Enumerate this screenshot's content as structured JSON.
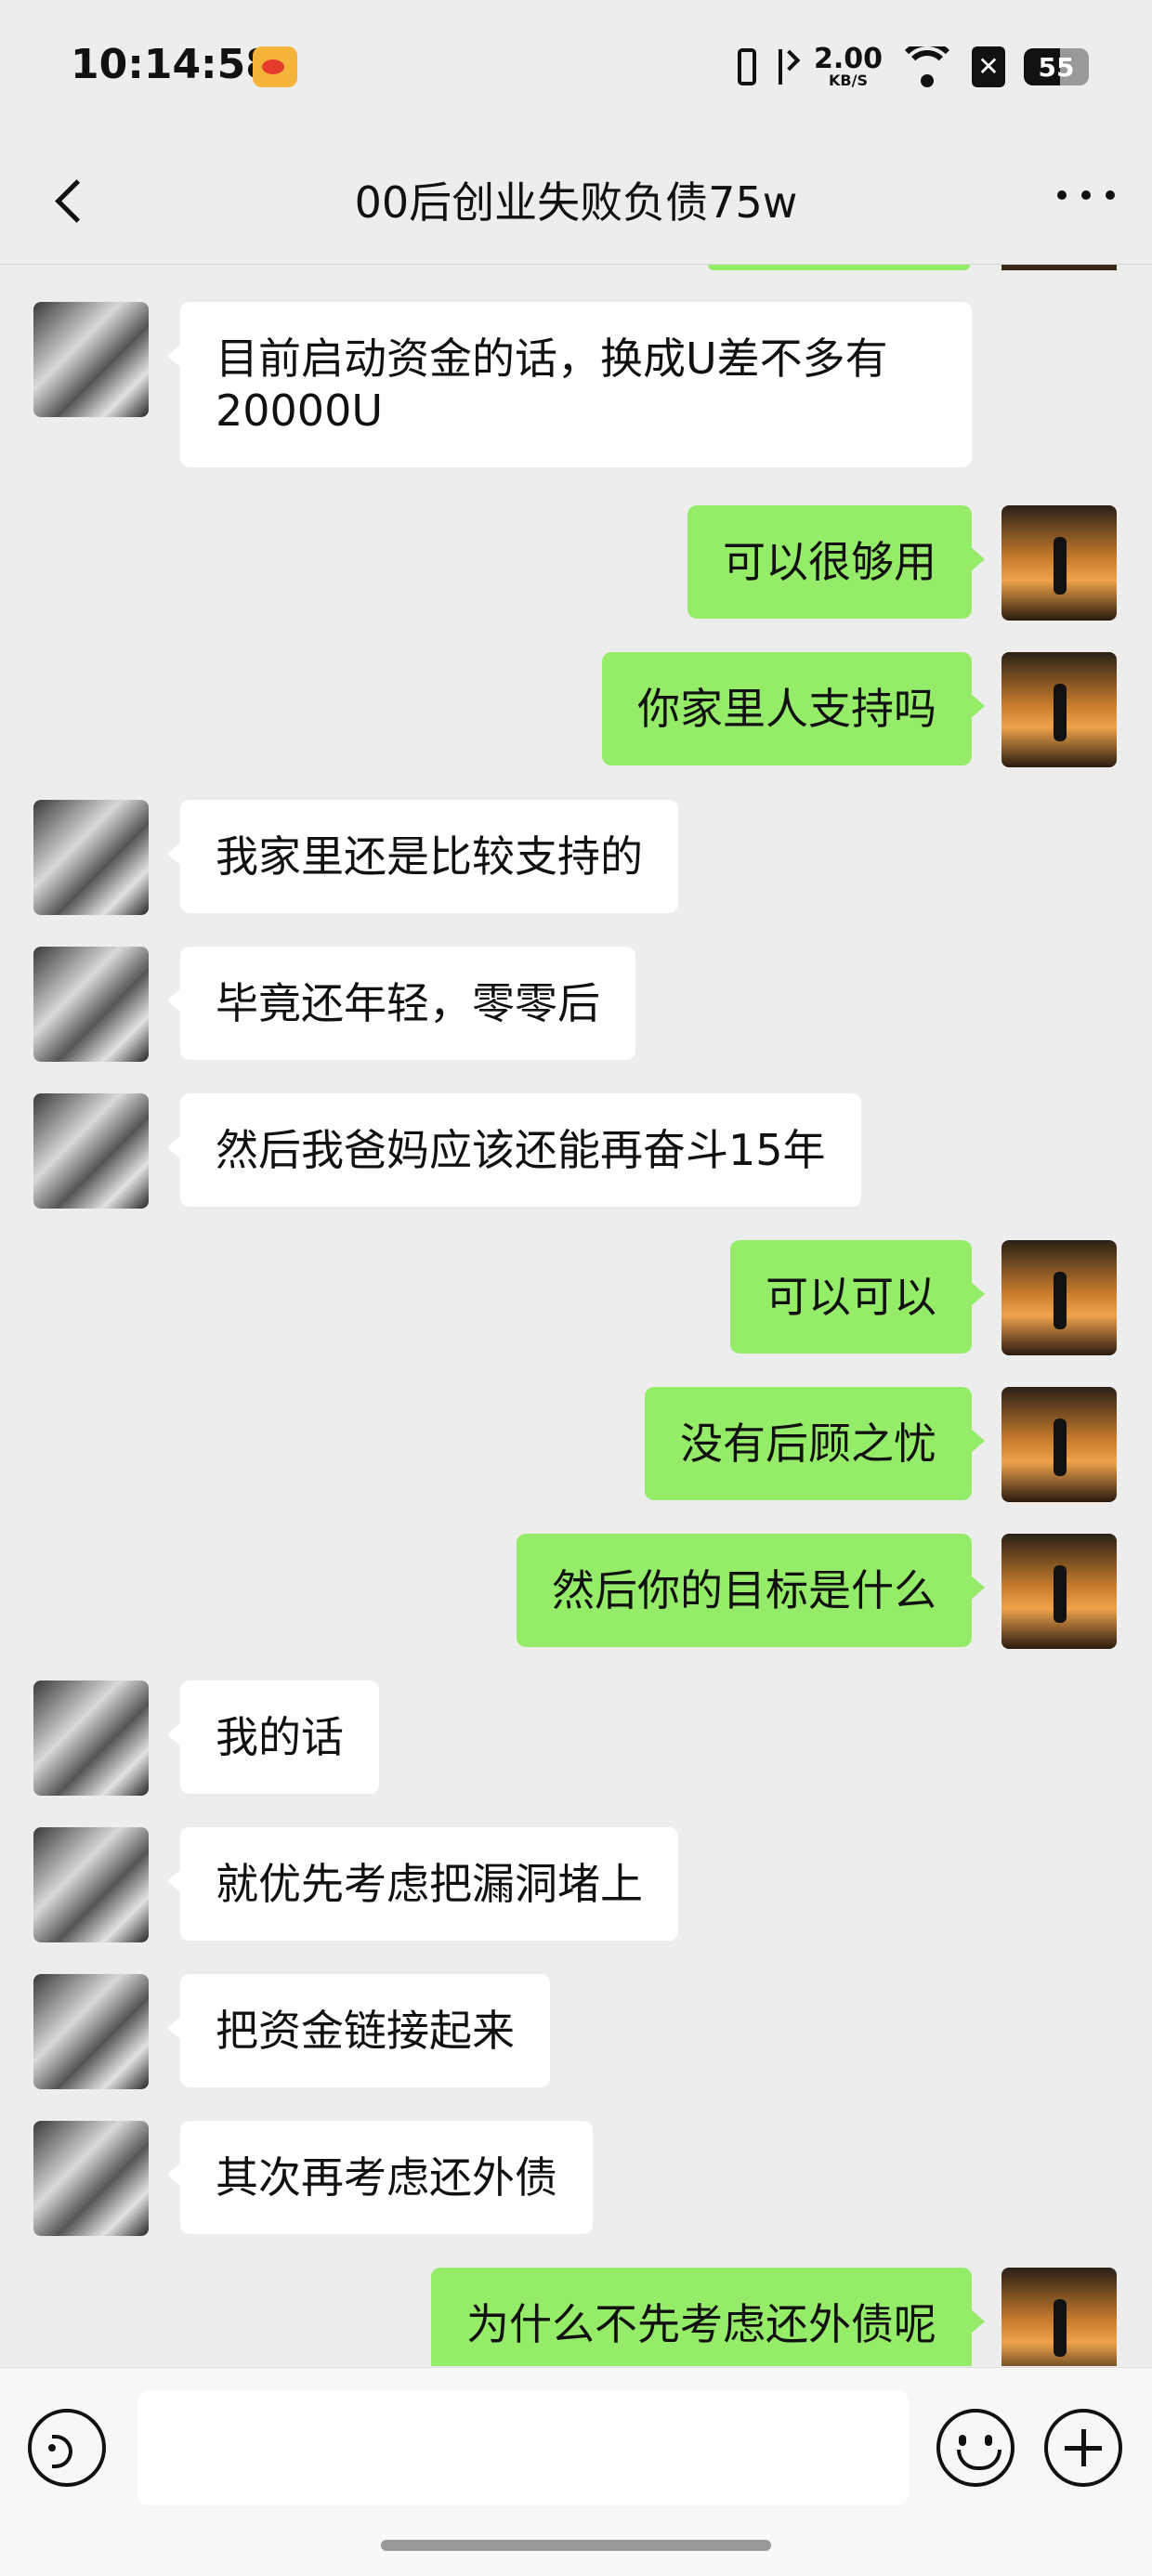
{
  "status_bar": {
    "time": "10:14:58",
    "net_speed_value": "2.00",
    "net_speed_unit": "KB/S",
    "battery": "55",
    "battery_level_percent": 55,
    "icons": [
      "weibo-icon",
      "vibrate-icon",
      "bluetooth-icon",
      "wifi-icon",
      "sim-off-icon",
      "battery-icon"
    ]
  },
  "nav": {
    "title": "00后创业失败负债75w",
    "icons": [
      "back-icon",
      "more-icon"
    ]
  },
  "messages": [
    {
      "side": "left",
      "text": "目前启动资金的话，换成U差不多有20000U"
    },
    {
      "side": "right",
      "text": "可以很够用"
    },
    {
      "side": "right",
      "text": "你家里人支持吗"
    },
    {
      "side": "left",
      "text": "我家里还是比较支持的"
    },
    {
      "side": "left",
      "text": "毕竟还年轻，零零后"
    },
    {
      "side": "left",
      "text": "然后我爸妈应该还能再奋斗15年"
    },
    {
      "side": "right",
      "text": "可以可以"
    },
    {
      "side": "right",
      "text": "没有后顾之忧"
    },
    {
      "side": "right",
      "text": "然后你的目标是什么"
    },
    {
      "side": "left",
      "text": "我的话"
    },
    {
      "side": "left",
      "text": "就优先考虑把漏洞堵上"
    },
    {
      "side": "left",
      "text": "把资金链接起来"
    },
    {
      "side": "left",
      "text": "其次再考虑还外债"
    },
    {
      "side": "right",
      "text": "为什么不先考虑还外债呢"
    }
  ],
  "input_bar": {
    "value": "",
    "icons": [
      "voice-icon",
      "emoji-icon",
      "plus-icon"
    ]
  }
}
